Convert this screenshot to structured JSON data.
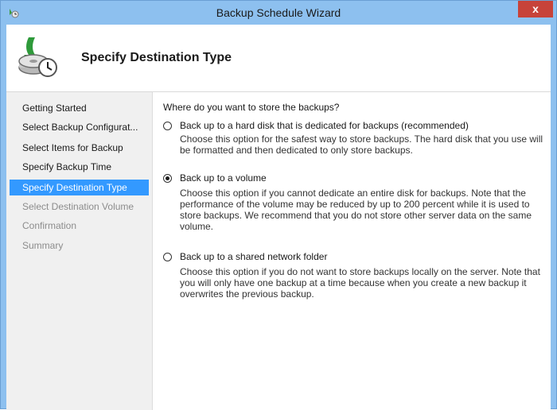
{
  "window": {
    "title": "Backup Schedule Wizard",
    "close_label": "x"
  },
  "header": {
    "title": "Specify Destination Type",
    "icon": "backup-disk-clock-icon"
  },
  "nav": {
    "items": [
      {
        "label": "Getting Started",
        "state": "normal"
      },
      {
        "label": "Select Backup Configurat...",
        "state": "normal"
      },
      {
        "label": "Select Items for Backup",
        "state": "normal"
      },
      {
        "label": "Specify Backup Time",
        "state": "normal"
      },
      {
        "label": "Specify Destination Type",
        "state": "active"
      },
      {
        "label": "Select Destination Volume",
        "state": "disabled"
      },
      {
        "label": "Confirmation",
        "state": "disabled"
      },
      {
        "label": "Summary",
        "state": "disabled"
      }
    ]
  },
  "main": {
    "question": "Where do you want to store the backups?",
    "options": [
      {
        "label": "Back up to a hard disk that is dedicated for backups (recommended)",
        "description": "Choose this option for the safest way to store backups. The hard disk that you use will be formatted and then dedicated to only store backups.",
        "checked": false
      },
      {
        "label": "Back up to a volume",
        "description": "Choose this option if you cannot dedicate an entire disk for backups. Note that the performance of the volume may be reduced by up to 200 percent while it is used to store backups. We recommend that you do not store other server data on the same volume.",
        "checked": true
      },
      {
        "label": "Back up to a shared network folder",
        "description": "Choose this option if you do not want to store backups locally on the server. Note that you will only have one backup at a time because when you create a new backup it overwrites the previous backup.",
        "checked": false
      }
    ]
  },
  "colors": {
    "titlebar": "#8dc0ef",
    "close": "#c7433a",
    "nav_active": "#3399ff",
    "nav_bg": "#f0f0f0"
  }
}
